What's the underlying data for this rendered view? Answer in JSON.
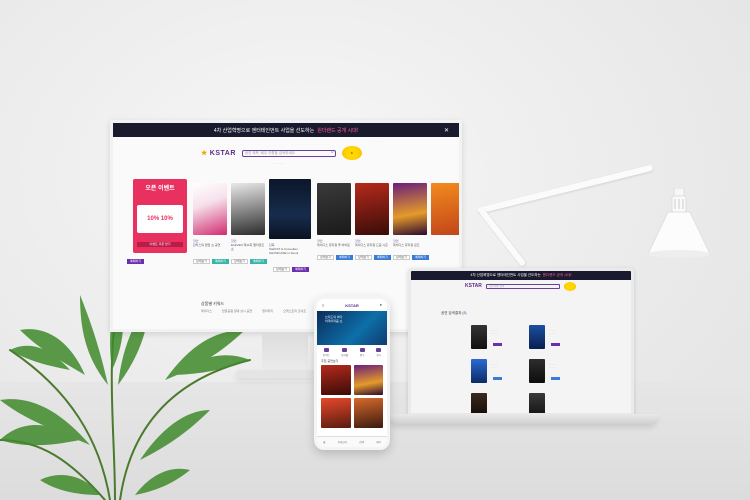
{
  "desktop": {
    "banner_text": "4차 산업혁명으로 엔터테인먼트 사업을 선도하는",
    "banner_highlight": "원더랜드 공개 시대!",
    "close": "✕",
    "logo": "KSTAR",
    "search_placeholder": "공연 제목, 배우 이름을 검색하세요",
    "event_title": "오픈 이벤트",
    "event_coupon": "10% 10%",
    "event_button": "이벤트 쿠폰 받기",
    "posters": [
      {
        "label": "할인",
        "title": "판타스틱 팬덤 쇼 공연",
        "sub": "2019.03.01 ~ 03.31"
      },
      {
        "label": "할인",
        "title": "ELEVEN 제11회 엘리먼트 쇼",
        "sub": "2019.04.12 ~ 04.20"
      },
      {
        "label": "단독",
        "title": "StarKST & Comedian",
        "sub": "SHOWCASE in Seoul"
      },
      {
        "label": "할인",
        "title": "레이디스 뮤지컬 올 어바웃",
        "sub": "2019.05.01 ~ 05.30"
      },
      {
        "label": "할인",
        "title": "레이디스 뮤지컬 드림 시즌",
        "sub": "2019.05.01 ~ 05.30"
      },
      {
        "label": "할인",
        "title": "레이디스 뮤지컬 퀸즈",
        "sub": "2019.06.01 ~ 06.30"
      }
    ],
    "btn_detail": "상세보기",
    "btn_reserve": "예매하기",
    "section_title": "상품별 키워드",
    "bottom_items": [
      "레이디스",
      "탑골공원 일대 상시 공연",
      "밀리터리",
      "오케스트라 콘서트"
    ]
  },
  "laptop": {
    "banner_text": "4차 산업혁명으로 엔터테인먼트 사업을 선도하는",
    "banner_highlight": "원더랜드 공개 시대!",
    "logo": "KSTAR",
    "search_placeholder": "공연 제목 검색",
    "section_title": "공연 검색결과",
    "section_count": "(8)"
  },
  "phone": {
    "logo": "KSTAR",
    "menu_icon": "≡",
    "search_icon": "⌕",
    "hero_line1": "브리드의 바다",
    "hero_line2": "아쿠아리움 쇼",
    "categories": [
      "콘서트",
      "뮤지컬",
      "연극",
      "전시"
    ],
    "section_title": "추천 공연보기",
    "tabbar": [
      "홈",
      "카테고리",
      "검색",
      "마이"
    ]
  },
  "colors": {
    "brand_purple": "#5b2a86",
    "accent_pink": "#e8315f",
    "banner_dark": "#1a1a2e",
    "button_blue": "#3a7bd5"
  }
}
